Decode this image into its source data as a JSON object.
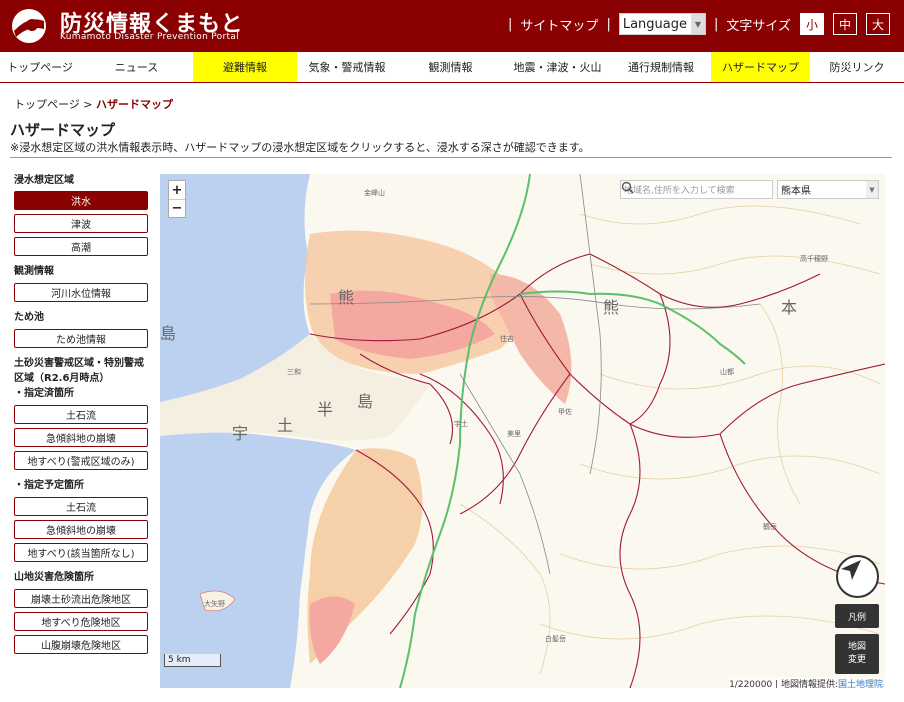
{
  "header": {
    "title": "防災情報くまもと",
    "subtitle": "Kumamoto Disaster Prevention Portal",
    "sitemap": "サイトマップ",
    "language": "Language",
    "font_size_label": "文字サイズ",
    "font_sizes": [
      "小",
      "中",
      "大"
    ]
  },
  "nav": [
    {
      "label": "トップページ",
      "highlight": false
    },
    {
      "label": "ニュース",
      "highlight": false
    },
    {
      "label": "避難情報",
      "highlight": true
    },
    {
      "label": "気象・警戒情報",
      "highlight": false
    },
    {
      "label": "観測情報",
      "highlight": false
    },
    {
      "label": "地震・津波・火山",
      "highlight": false
    },
    {
      "label": "通行規制情報",
      "highlight": false
    },
    {
      "label": "ハザードマップ",
      "highlight": true
    },
    {
      "label": "防災リンク",
      "highlight": false
    }
  ],
  "breadcrumb": {
    "home": "トップページ",
    "sep": ">",
    "current": "ハザードマップ"
  },
  "page": {
    "title": "ハザードマップ",
    "note": "※浸水想定区域の洪水情報表示時、ハザードマップの浸水想定区域をクリックすると、浸水する深さが確認できます。"
  },
  "sidebar": {
    "flood_head": "浸水想定区域",
    "flood": [
      "洪水",
      "津波",
      "高潮"
    ],
    "obs_head": "観測情報",
    "obs": [
      "河川水位情報"
    ],
    "pond_head": "ため池",
    "pond": [
      "ため池情報"
    ],
    "sediment_head_1": "土砂災害警戒区域・特別警戒",
    "sediment_head_2": "区域（R2.6月時点）",
    "designated_head": "・指定済箇所",
    "designated": [
      "土石流",
      "急傾斜地の崩壊",
      "地すべり(警戒区域のみ)"
    ],
    "planned_head": "・指定予定箇所",
    "planned": [
      "土石流",
      "急傾斜地の崩壊",
      "地すべり(該当箇所なし)"
    ],
    "mountain_head": "山地災害危険箇所",
    "mountain": [
      "崩壊土砂流出危険地区",
      "地すべり危険地区",
      "山腹崩壊危険地区"
    ]
  },
  "map": {
    "zoom_in": "+",
    "zoom_out": "−",
    "search_placeholder": "地域名,住所を入力して検索",
    "prefecture": "熊本県",
    "scale": "5 km",
    "attribution_prefix": "1/220000 | 地図情報提供:",
    "attribution_link": "国土地理院",
    "legend_btn": "凡例",
    "change_btn_1": "地図",
    "change_btn_2": "変更",
    "labels": {
      "kuma": "熊",
      "kuma2": "熊",
      "hon": "本",
      "shima": "島",
      "u": "宇",
      "do": "土",
      "han": "半",
      "shima2": "島",
      "kinpozan": "金峰山",
      "takachiho": "高千穂野",
      "otomo": "大矢野",
      "shirahata": "白髪岳",
      "kosa": "甲佐",
      "misato": "美里",
      "uto": "宇土",
      "yamato": "山都",
      "sanwa": "三和",
      "sumiyoshi": "住吉",
      "kuri": "鶴岳"
    }
  },
  "colors": {
    "brand": "#8b0000",
    "nav_highlight": "#ffff00",
    "sea": "#bcd0ef",
    "flood": "#f4a8a0",
    "boundary": "#a0183c"
  }
}
